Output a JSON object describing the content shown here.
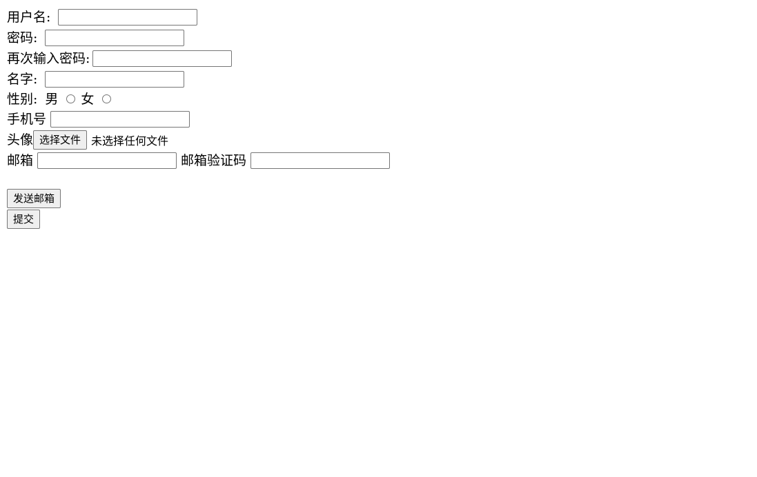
{
  "form": {
    "username_label": "用户名:",
    "password_label": "密码:",
    "password_confirm_label": "再次输入密码:",
    "name_label": "名字:",
    "gender_label": "性别:",
    "gender_options": [
      "男",
      "女"
    ],
    "phone_label": "手机号",
    "avatar_label": "头像",
    "file_button_label": "选择文件",
    "file_status": "未选择任何文件",
    "email_label": "邮箱",
    "email_code_label": "邮箱验证码",
    "send_email_button": "发送邮箱",
    "submit_button": "提交"
  }
}
